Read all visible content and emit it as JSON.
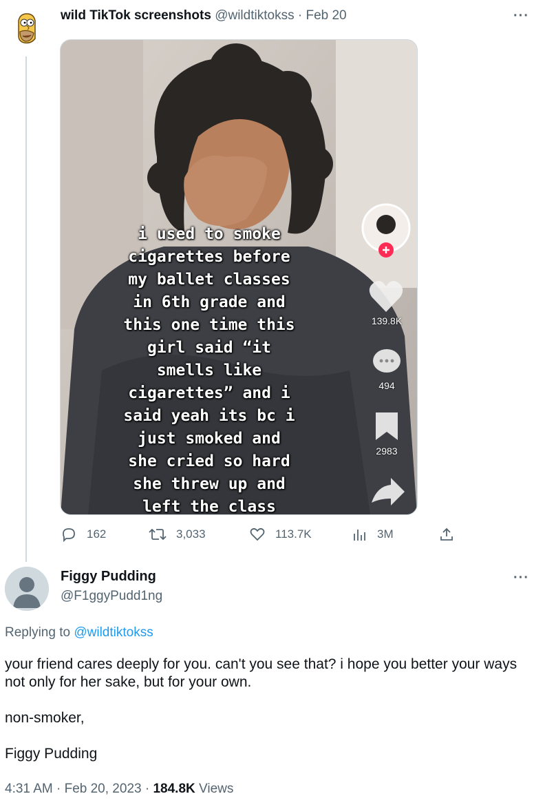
{
  "tweet": {
    "author_name": "wild TikTok screenshots",
    "author_handle": "@wildtiktokss",
    "date": "Feb 20",
    "more_label": "···",
    "media": {
      "caption": "i used to smoke\ncigarettes before\nmy ballet classes\nin 6th grade and\nthis one time this\ngirl said “it\nsmells like\ncigarettes” and i\nsaid yeah its bc i\njust smoked and\nshe cried so hard\nshe threw up and\nleft the class",
      "likes": "139.8K",
      "comments": "494",
      "saves": "2983"
    },
    "stats": {
      "replies": "162",
      "retweets": "3,033",
      "likes": "113.7K",
      "views": "3M"
    }
  },
  "reply": {
    "author_name": "Figgy Pudding",
    "author_handle": "@F1ggyPudd1ng",
    "more_label": "···",
    "replying_prefix": "Replying to",
    "replying_handle": "@wildtiktokss",
    "paragraph1": "your friend cares deeply for you. can't you see that? i hope you better your ways not only for her sake, but for your own.",
    "paragraph2": "non-smoker,",
    "paragraph3": "Figgy Pudding",
    "time": "4:31 AM · Feb 20, 2023 · ",
    "views_count": "184.8K",
    "views_label": " Views"
  },
  "colors": {
    "accent": "#1d9bf0",
    "secondary_text": "#536471",
    "tiktok_red": "#fe2c55"
  }
}
